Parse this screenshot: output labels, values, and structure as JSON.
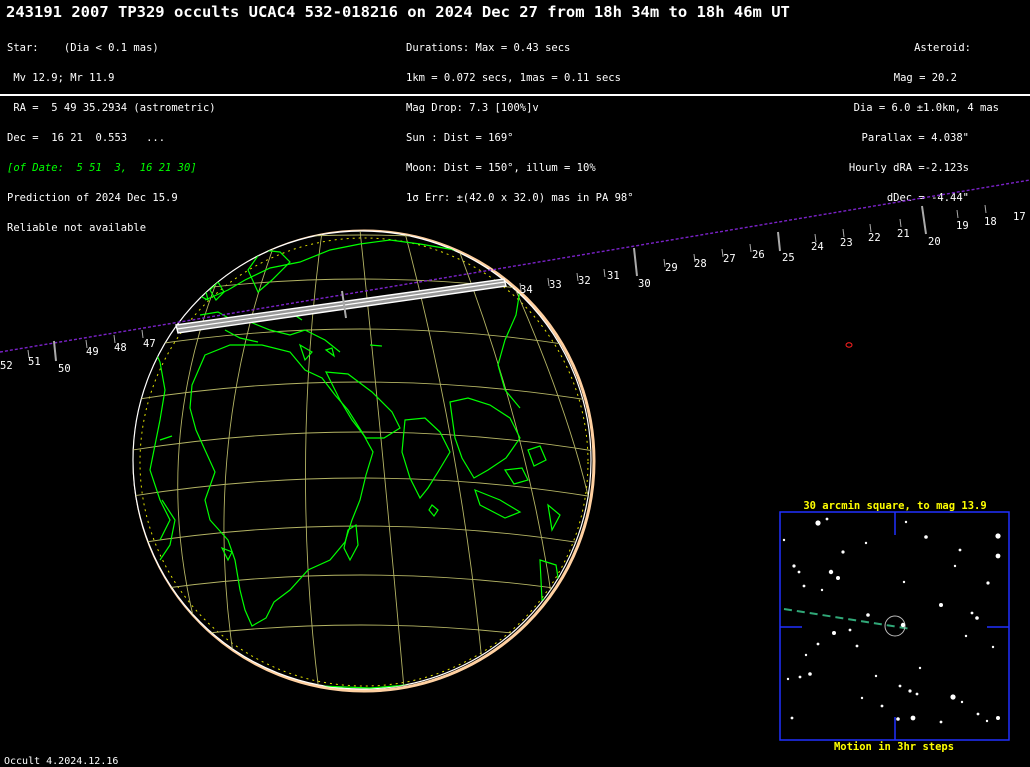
{
  "header": {
    "title": "243191 2007 TP329 occults UCAC4 532-018216 on 2024 Dec 27 from 18h 34m to 18h 46m UT"
  },
  "star_block": [
    "Star:    (Dia < 0.1 mas)",
    " Mv 12.9; Mr 11.9",
    " RA =  5 49 35.2934 (astrometric)",
    "Dec =  16 21  0.553   ...",
    "[of Date:  5 51  3,  16 21 30]",
    "Prediction of 2024 Dec 15.9",
    "Reliable not available"
  ],
  "event_block": [
    "Durations: Max = 0.43 secs",
    "1km = 0.072 secs, 1mas = 0.11 secs",
    "Mag Drop: 7.3 [100%]v",
    "Sun : Dist = 169°",
    "Moon: Dist = 150°, illum = 10%",
    "1σ Err: ±(42.0 x 32.0) mas in PA 98°"
  ],
  "asteroid_block": [
    "Asteroid:",
    "Mag = 20.2",
    "Dia = 6.0 ±1.0km, 4 mas",
    "Parallax = 4.038\"",
    "Hourly dRA =-2.123s",
    "dDec = -4.44\""
  ],
  "footer": "Occult 4.2024.12.16",
  "starchart": {
    "title": "30 arcmin square, to mag 13.9",
    "caption": "Motion in 3hr steps"
  },
  "track_minute_labels": [
    "17",
    "18",
    "19",
    "20",
    "21",
    "22",
    "23",
    "24",
    "25",
    "26",
    "27",
    "28",
    "29",
    "30",
    "31",
    "32",
    "33",
    "34",
    "47",
    "48",
    "49",
    "50",
    "51",
    "52"
  ],
  "colors": {
    "background": "#000000",
    "text": "#ffffff",
    "green_text": "#00ff00",
    "coast": "#00ff00",
    "graticule": "#b4b464",
    "path_track": "#7a22c8",
    "path_band": "#ffffff",
    "starchart_border": "#2030ff",
    "starchart_title": "#ffff00",
    "motion": "#30a878"
  }
}
